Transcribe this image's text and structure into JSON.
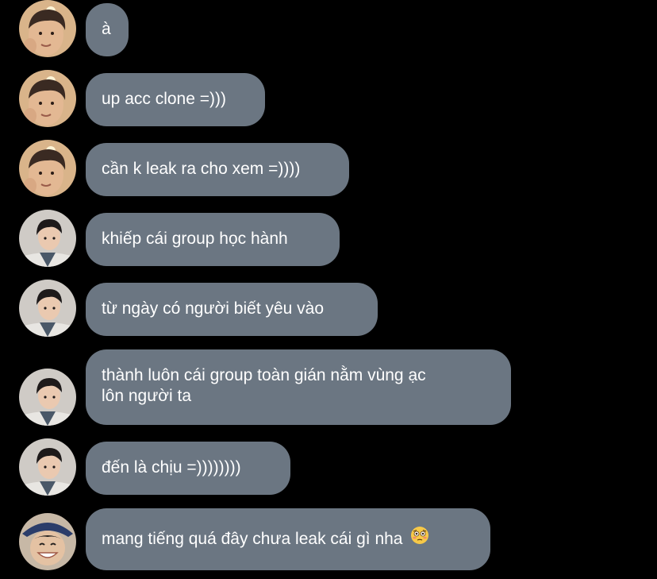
{
  "colors": {
    "background": "#000000",
    "bubble": "#6b7682",
    "text": "#ffffff"
  },
  "messages": [
    {
      "text": "à",
      "avatar": "avatar-a"
    },
    {
      "text": "up acc clone =)))",
      "avatar": "avatar-a"
    },
    {
      "text": "cần k leak ra cho xem =))))",
      "avatar": "avatar-a"
    },
    {
      "text": "khiếp cái group học hành",
      "avatar": "avatar-b"
    },
    {
      "text": "từ ngày có người biết yêu vào",
      "avatar": "avatar-b"
    },
    {
      "lines": [
        "thành luôn cái group toàn gián nằm vùng ạc",
        "lôn người ta"
      ],
      "avatar": "avatar-b"
    },
    {
      "text": "đến là chịu =))))))))",
      "avatar": "avatar-b"
    },
    {
      "text": "mang tiếng quá đây chưa leak cái gì nha",
      "emoji": "flushed-face-emoji",
      "avatar": "avatar-c"
    }
  ]
}
